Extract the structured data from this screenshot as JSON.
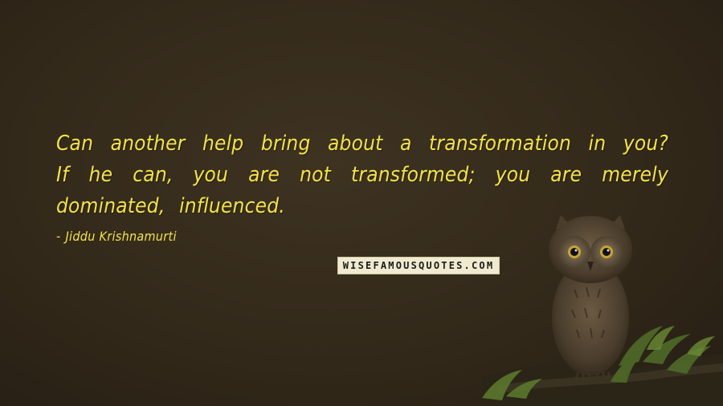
{
  "quote": {
    "text": "Can another help bring about a transformation in you? If he can, you are not transformed; you are merely dominated, influenced."
  },
  "author": {
    "dash": "-",
    "name": "Jiddu Krishnamurti"
  },
  "watermark": {
    "text": "WISEFAMOUSQUOTES.COM"
  },
  "colors": {
    "text": "#f3e24a",
    "background": "#33291a"
  }
}
